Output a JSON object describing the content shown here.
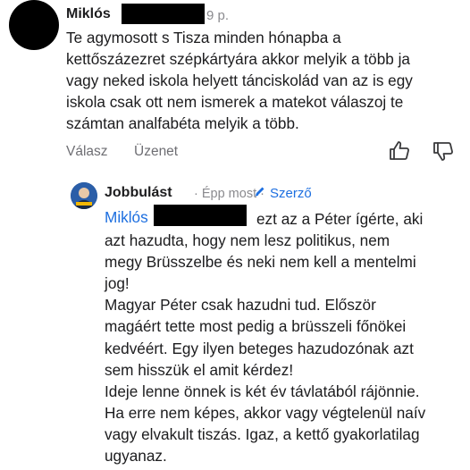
{
  "comment": {
    "author": "Miklós",
    "time": "9 p.",
    "text": "Te agymosott s Tisza minden hónapba a\nkettőszázezret szépkártyára akkor melyik a több ja\nvagy neked iskola helyett tánciskolád van az is egy\niskola csak ott nem ismerek a matekot válaszoj te\nszámtan analfabéta melyik a több.",
    "actions": {
      "reply": "Válasz",
      "message": "Üzenet"
    },
    "icons": {
      "like": "thumbs-up-icon",
      "dislike": "thumbs-down-icon"
    }
  },
  "reply": {
    "author": "Jobbulást",
    "meta": "· Épp most ·",
    "badge": "Szerző",
    "badge_icon": "pencil-icon",
    "mention": "Miklós",
    "first_line_rest": "ezt az a Péter ígérte, aki",
    "lines": [
      "azt hazudta, hogy nem lesz politikus, nem",
      "megy Brüsszelbe és neki nem kell a mentelmi",
      "jog!",
      "Magyar Péter csak hazudni tud. Először",
      "magáért tette most pedig a brüsszeli főnökei",
      "kedvéért. Egy ilyen beteges hazudozónak azt",
      "sem hisszük el amit kérdez!",
      "Ideje lenne önnek is két év távlatából rájönnie.",
      "Ha erre nem képes, akkor vagy végtelenül naív",
      "vagy elvakult tiszás. Igaz, a kettő gyakorlatilag",
      "ugyanaz."
    ]
  },
  "colors": {
    "link": "#1d6fe0",
    "muted": "#8a8a8e",
    "text": "#1c1c1e"
  }
}
